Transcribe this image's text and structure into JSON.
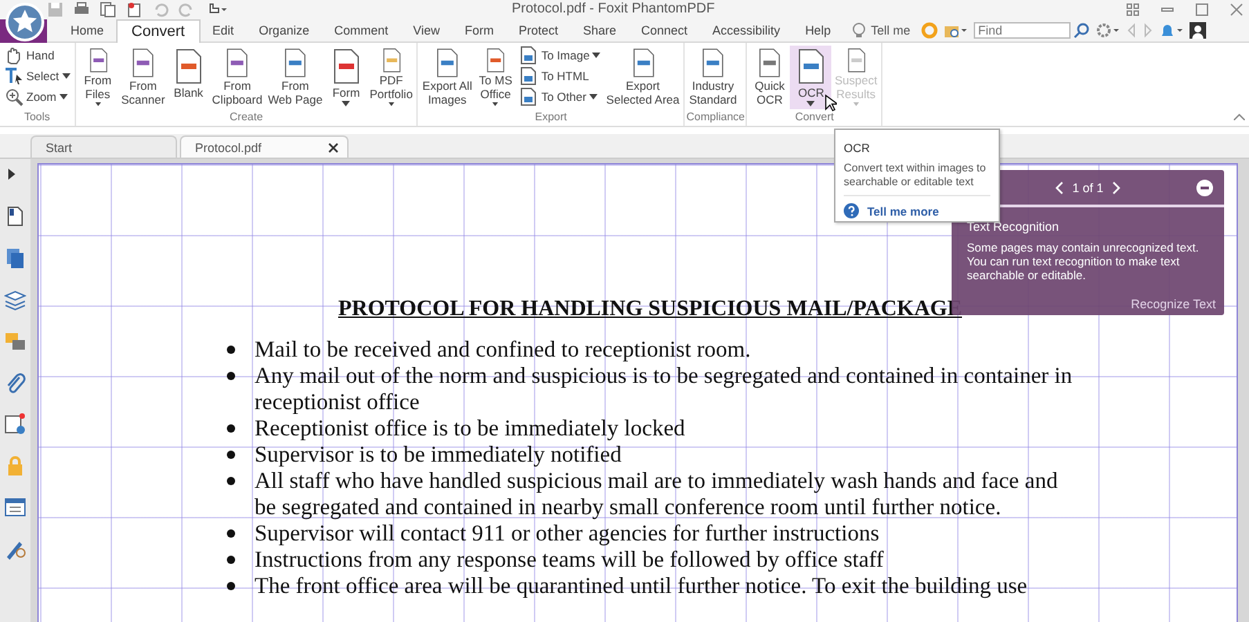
{
  "window": {
    "title": "Protocol.pdf - Foxit PhantomPDF"
  },
  "menu_tabs": [
    {
      "label": "Home",
      "selected": false
    },
    {
      "label": "Convert",
      "selected": true
    },
    {
      "label": "Edit",
      "selected": false
    },
    {
      "label": "Organize",
      "selected": false
    },
    {
      "label": "Comment",
      "selected": false
    },
    {
      "label": "View",
      "selected": false
    },
    {
      "label": "Form",
      "selected": false
    },
    {
      "label": "Protect",
      "selected": false
    },
    {
      "label": "Share",
      "selected": false
    },
    {
      "label": "Connect",
      "selected": false
    },
    {
      "label": "Accessibility",
      "selected": false
    },
    {
      "label": "Help",
      "selected": false
    }
  ],
  "tell_me": {
    "label": "Tell me"
  },
  "search": {
    "placeholder": "Find"
  },
  "ribbon_groups": [
    {
      "label": "Tools",
      "items": [
        {
          "kind": "small",
          "label": "Hand",
          "dropdown": false,
          "disabled": false,
          "highlighted": false
        },
        {
          "kind": "small",
          "label": "Select",
          "dropdown": true,
          "disabled": false,
          "highlighted": false
        },
        {
          "kind": "small",
          "label": "Zoom",
          "dropdown": true,
          "disabled": false,
          "highlighted": false
        }
      ]
    },
    {
      "label": "Create",
      "items": [
        {
          "kind": "large",
          "label": "From\nFiles",
          "dropdown": true,
          "disabled": false,
          "highlighted": false
        },
        {
          "kind": "large",
          "label": "From\nScanner",
          "dropdown": false,
          "disabled": false,
          "highlighted": false
        },
        {
          "kind": "large",
          "label": "Blank",
          "dropdown": false,
          "disabled": false,
          "highlighted": false
        },
        {
          "kind": "large",
          "label": "From\nClipboard",
          "dropdown": false,
          "disabled": false,
          "highlighted": false
        },
        {
          "kind": "large",
          "label": "From\nWeb Page",
          "dropdown": false,
          "disabled": false,
          "highlighted": false
        },
        {
          "kind": "large",
          "label": "Form",
          "dropdown": true,
          "disabled": false,
          "highlighted": false
        },
        {
          "kind": "large",
          "label": "PDF\nPortfolio",
          "dropdown": true,
          "disabled": false,
          "highlighted": false
        }
      ]
    },
    {
      "label": "Export",
      "items": [
        {
          "kind": "large",
          "label": "Export All\nImages",
          "dropdown": false,
          "disabled": false,
          "highlighted": false
        },
        {
          "kind": "large",
          "label": "To MS\nOffice",
          "dropdown": true,
          "disabled": false,
          "highlighted": false
        },
        {
          "kind": "small",
          "label": "To Image",
          "dropdown": true,
          "disabled": false,
          "highlighted": false
        },
        {
          "kind": "small",
          "label": "To HTML",
          "dropdown": false,
          "disabled": false,
          "highlighted": false
        },
        {
          "kind": "small",
          "label": "To Other",
          "dropdown": true,
          "disabled": false,
          "highlighted": false
        },
        {
          "kind": "large",
          "label": "Export\nSelected Area",
          "dropdown": false,
          "disabled": false,
          "highlighted": false
        }
      ]
    },
    {
      "label": "Compliance",
      "items": [
        {
          "kind": "large",
          "label": "Industry\nStandard",
          "dropdown": false,
          "disabled": false,
          "highlighted": false
        }
      ]
    },
    {
      "label": "Convert",
      "items": [
        {
          "kind": "large",
          "label": "Quick\nOCR",
          "dropdown": false,
          "disabled": false,
          "highlighted": false
        },
        {
          "kind": "large",
          "label": "OCR",
          "dropdown": true,
          "disabled": false,
          "highlighted": true
        },
        {
          "kind": "large",
          "label": "Suspect\nResults",
          "dropdown": true,
          "disabled": true,
          "highlighted": false
        }
      ]
    }
  ],
  "doc_tabs": [
    {
      "label": "Start",
      "selected": false,
      "closable": false
    },
    {
      "label": "Protocol.pdf",
      "selected": true,
      "closable": true
    }
  ],
  "document": {
    "heading": "PROTOCOL FOR HANDLING SUSPICIOUS MAIL/PACKAGE",
    "bullets": [
      "Mail to be received and confined to receptionist room.",
      "Any mail out of the norm and suspicious is to be segregated and contained in container in\nreceptionist office",
      "Receptionist office is to be immediately locked",
      "Supervisor is to be immediately notified",
      "All staff who have handled suspicious mail are to immediately wash hands and face and\nbe segregated and contained in nearby small conference room until further notice.",
      "Supervisor will contact 911 or other agencies for further instructions",
      "Instructions from any response teams will be followed by office staff",
      "The front office area will be quarantined until further notice.  To exit the building use"
    ]
  },
  "tooltip": {
    "title": "OCR",
    "text": "Convert text within images to\nsearchable or editable text",
    "link": "Tell me more"
  },
  "notice_panel": {
    "pager": "1 of 1",
    "title": "Text Recognition",
    "text": "Some pages may contain unrecognized text.\nYou can run text recognition to make text\nsearchable or editable.",
    "action": "Recognize Text"
  }
}
